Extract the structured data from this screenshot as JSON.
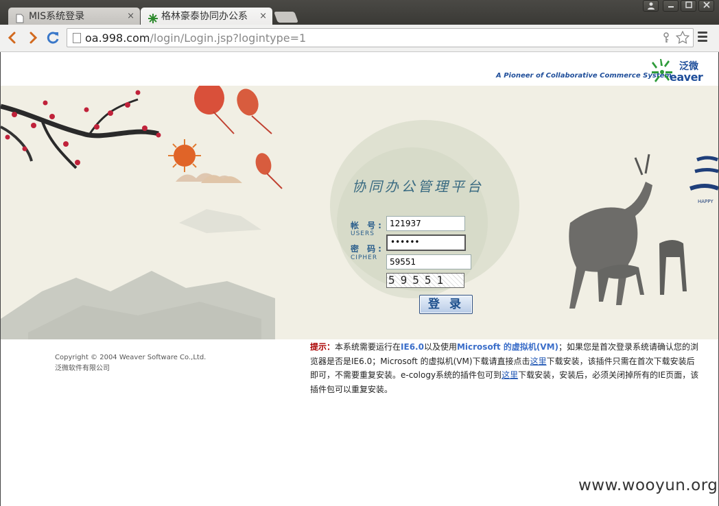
{
  "browser": {
    "tabs": [
      {
        "label": "MIS系统登录",
        "active": false
      },
      {
        "label": "格林豪泰协同办公系",
        "active": true
      }
    ],
    "close_glyph": "×",
    "url_host": "oa.998.com",
    "url_path": "/login/Login.jsp?logintype=1",
    "icons": [
      "back-icon",
      "forward-icon",
      "reload-icon",
      "page-icon",
      "key-icon",
      "star-icon",
      "menu-icon"
    ]
  },
  "header": {
    "tagline": "A Pioneer of Collaborative Commerce System",
    "logo_cn": "泛微",
    "logo_en": "eaver"
  },
  "login": {
    "title": "协同办公管理平台",
    "user_label": "帐 号:",
    "user_sub": "USERS",
    "user_value": "121937",
    "pass_label": "密 码:",
    "pass_sub": "CIPHER",
    "pass_value": "••••••",
    "code_value": "59551",
    "captcha_text": "59551",
    "button": "登 录"
  },
  "banner": {
    "happy_text": "HAPPY"
  },
  "footer": {
    "copyright": "Copyright © 2004 Weaver Software Co.,Ltd.",
    "company": "泛微软件有限公司",
    "tip_label": "提示：",
    "tip_1": "本系统需要运行在",
    "tip_ie": "IE6.0",
    "tip_2": "以及使用",
    "tip_vm": "Microsoft 的虚拟机(VM)",
    "tip_3": "；如果您是首次登录系统请确认您的浏览器是否是IE6.0；Microsoft 的虚拟机(VM)下载请直接点击",
    "tip_link1": "这里",
    "tip_4": "下载安装，该插件只需在首次下载安装后即可，不需要重复安装。e-cology系统的插件包可到",
    "tip_link2": "这里",
    "tip_5": "下载安装，安装后，必须关闭掉所有的IE页面，该插件包可以重复安装。"
  },
  "watermark": "www.wooyun.org",
  "colors": {
    "accent": "#1f4e9a",
    "banner_bg": "#f1efe4",
    "tip_red": "#aa0000"
  }
}
